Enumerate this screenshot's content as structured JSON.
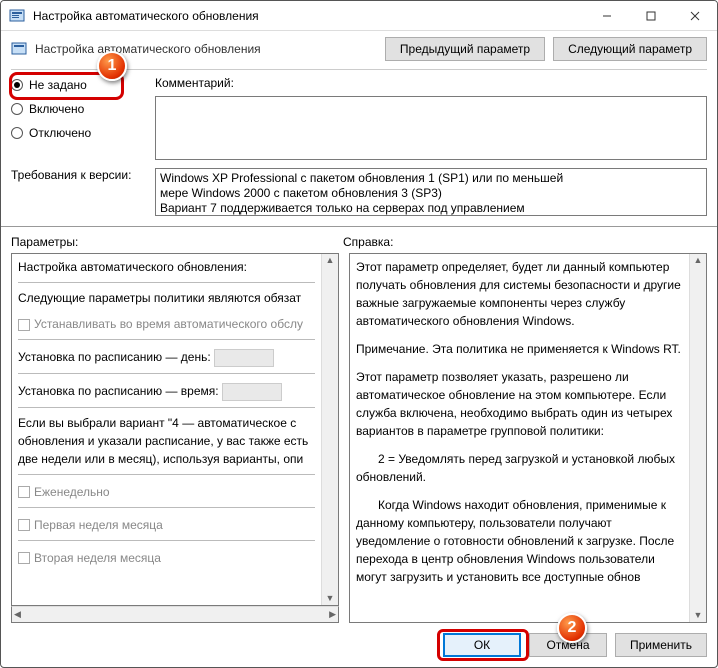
{
  "window": {
    "title": "Настройка автоматического обновления"
  },
  "header": {
    "title": "Настройка автоматического обновления",
    "prev": "Предыдущий параметр",
    "next": "Следующий параметр"
  },
  "state": {
    "not_configured": "Не задано",
    "enabled": "Включено",
    "disabled": "Отключено"
  },
  "comment": {
    "label": "Комментарий:"
  },
  "requirements": {
    "label": "Требования к версии:",
    "text_l1": "Windows XP Professional с пакетом обновления 1 (SP1) или по меньшей",
    "text_l2": "мере Windows 2000 с пакетом обновления 3 (SP3)",
    "text_l3": "Вариант 7 поддерживается только на серверах под управлением"
  },
  "labels": {
    "params": "Параметры:",
    "help": "Справка:"
  },
  "options": {
    "title": "Настройка автоматического обновления:",
    "note": "Следующие параметры политики являются обязат",
    "cb_install_maint": "Устанавливать во время автоматического обслу",
    "sched_day": "Установка по расписанию — день:",
    "sched_time": "Установка по расписанию — время:",
    "variant4_l1": "Если вы выбрали вариант \"4 — автоматическое с",
    "variant4_l2": "обновления и указали расписание, у вас также есть",
    "variant4_l3": "две недели или в месяц), используя варианты, опи",
    "cb_weekly": "Еженедельно",
    "cb_first_week": "Первая неделя месяца",
    "cb_second_week": "Вторая неделя месяца"
  },
  "help": {
    "p1": "Этот параметр определяет, будет ли данный компьютер получать обновления для системы безопасности и другие важные загружаемые компоненты через службу автоматического обновления Windows.",
    "p2": "Примечание. Эта политика не применяется к Windows RT.",
    "p3": "Этот параметр позволяет указать, разрешено ли автоматическое обновление на этом компьютере. Если служба включена, необходимо выбрать один из четырех вариантов в параметре групповой политики:",
    "p4": "2 = Уведомлять перед загрузкой и установкой любых обновлений.",
    "p5": "Когда Windows находит обновления, применимые к данному компьютеру, пользователи получают уведомление о готовности обновлений к загрузке. После перехода в центр обновления Windows пользователи могут загрузить и установить все доступные обнов"
  },
  "footer": {
    "ok": "ОК",
    "cancel": "Отмена",
    "apply": "Применить"
  },
  "callouts": {
    "one": "1",
    "two": "2"
  }
}
